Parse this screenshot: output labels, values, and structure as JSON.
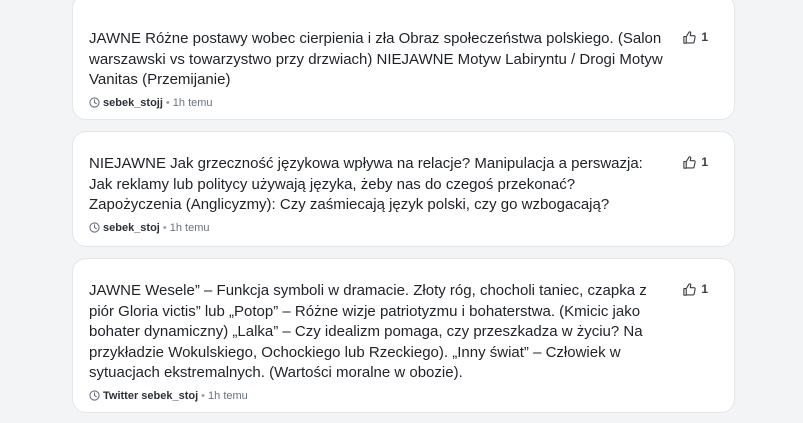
{
  "posts": [
    {
      "text": "JAWNE Różne postawy wobec cierpienia i zła Obraz społeczeństwa polskiego. (Salon warszawski vs towarzystwo przy drzwiach) NIEJAWNE Motyw Labiryntu / Drogi Motyw Vanitas (Przemijanie)",
      "author": "sebek_stojj",
      "time": "1h temu",
      "likes": "1",
      "icon": "clock-icon"
    },
    {
      "text": "NIEJAWNE Jak grzeczność językowa wpływa na relacje? Manipulacja a perswazja: Jak reklamy lub politycy używają języka, żeby nas do czegoś przekonać? Zapożyczenia (Anglicyzmy): Czy zaśmiecają język polski, czy go wzbogacają?",
      "author": "sebek_stoj",
      "time": "1h temu",
      "likes": "1",
      "icon": "clock-icon"
    },
    {
      "text": "JAWNE Wesele” – Funkcja symboli w dramacie. Złoty róg, chocholi taniec, czapka z piór Gloria victis” lub „Potop” – Różne wizje patriotyzmu i bohaterstwa. (Kmicic jako bohater dynamiczny) „Lalka” – Czy idealizm pomaga, czy przeszkadza w życiu? Na przykładzie Wokulskiego, Ochockiego lub Rzeckiego). „Inny świat” – Człowiek w sytuacjach ekstremalnych. (Wartości moralne w obozie).",
      "author": "Twitter sebek_stoj",
      "time": "1h temu",
      "likes": "1",
      "icon": "twitter-icon"
    }
  ],
  "separator": "•"
}
